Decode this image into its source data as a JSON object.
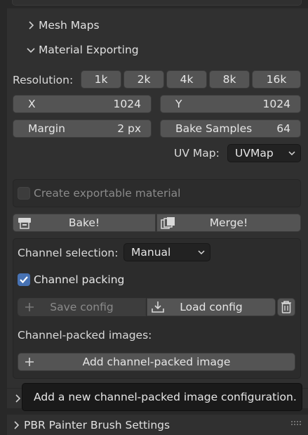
{
  "sections": {
    "mesh_maps": "Mesh Maps",
    "material_exporting": "Material Exporting",
    "brush_settings": "PBR Painter Brush Settings"
  },
  "resolution": {
    "label": "Resolution:",
    "options": [
      "1k",
      "2k",
      "4k",
      "8k",
      "16k"
    ]
  },
  "size": {
    "x_label": "X",
    "x_value": "1024",
    "y_label": "Y",
    "y_value": "1024"
  },
  "margin": {
    "label": "Margin",
    "value": "2 px"
  },
  "bake_samples": {
    "label": "Bake Samples",
    "value": "64"
  },
  "uv_map": {
    "label": "UV Map:",
    "value": "UVMap"
  },
  "create_material": {
    "label": "Create exportable material",
    "checked": false
  },
  "actions": {
    "bake": "Bake!",
    "merge": "Merge!"
  },
  "channel": {
    "selection_label": "Channel selection:",
    "selection_value": "Manual",
    "packing_label": "Channel packing",
    "packing_checked": true,
    "save_config": "Save config",
    "load_config": "Load config",
    "packed_images_label": "Channel-packed images:",
    "add_packed_image": "Add channel-packed image"
  },
  "tooltip": "Add a new channel-packed image configuration.",
  "colors": {
    "accent": "#4772b3",
    "bg": "#282828",
    "panel": "#303030",
    "button": "#545454"
  }
}
